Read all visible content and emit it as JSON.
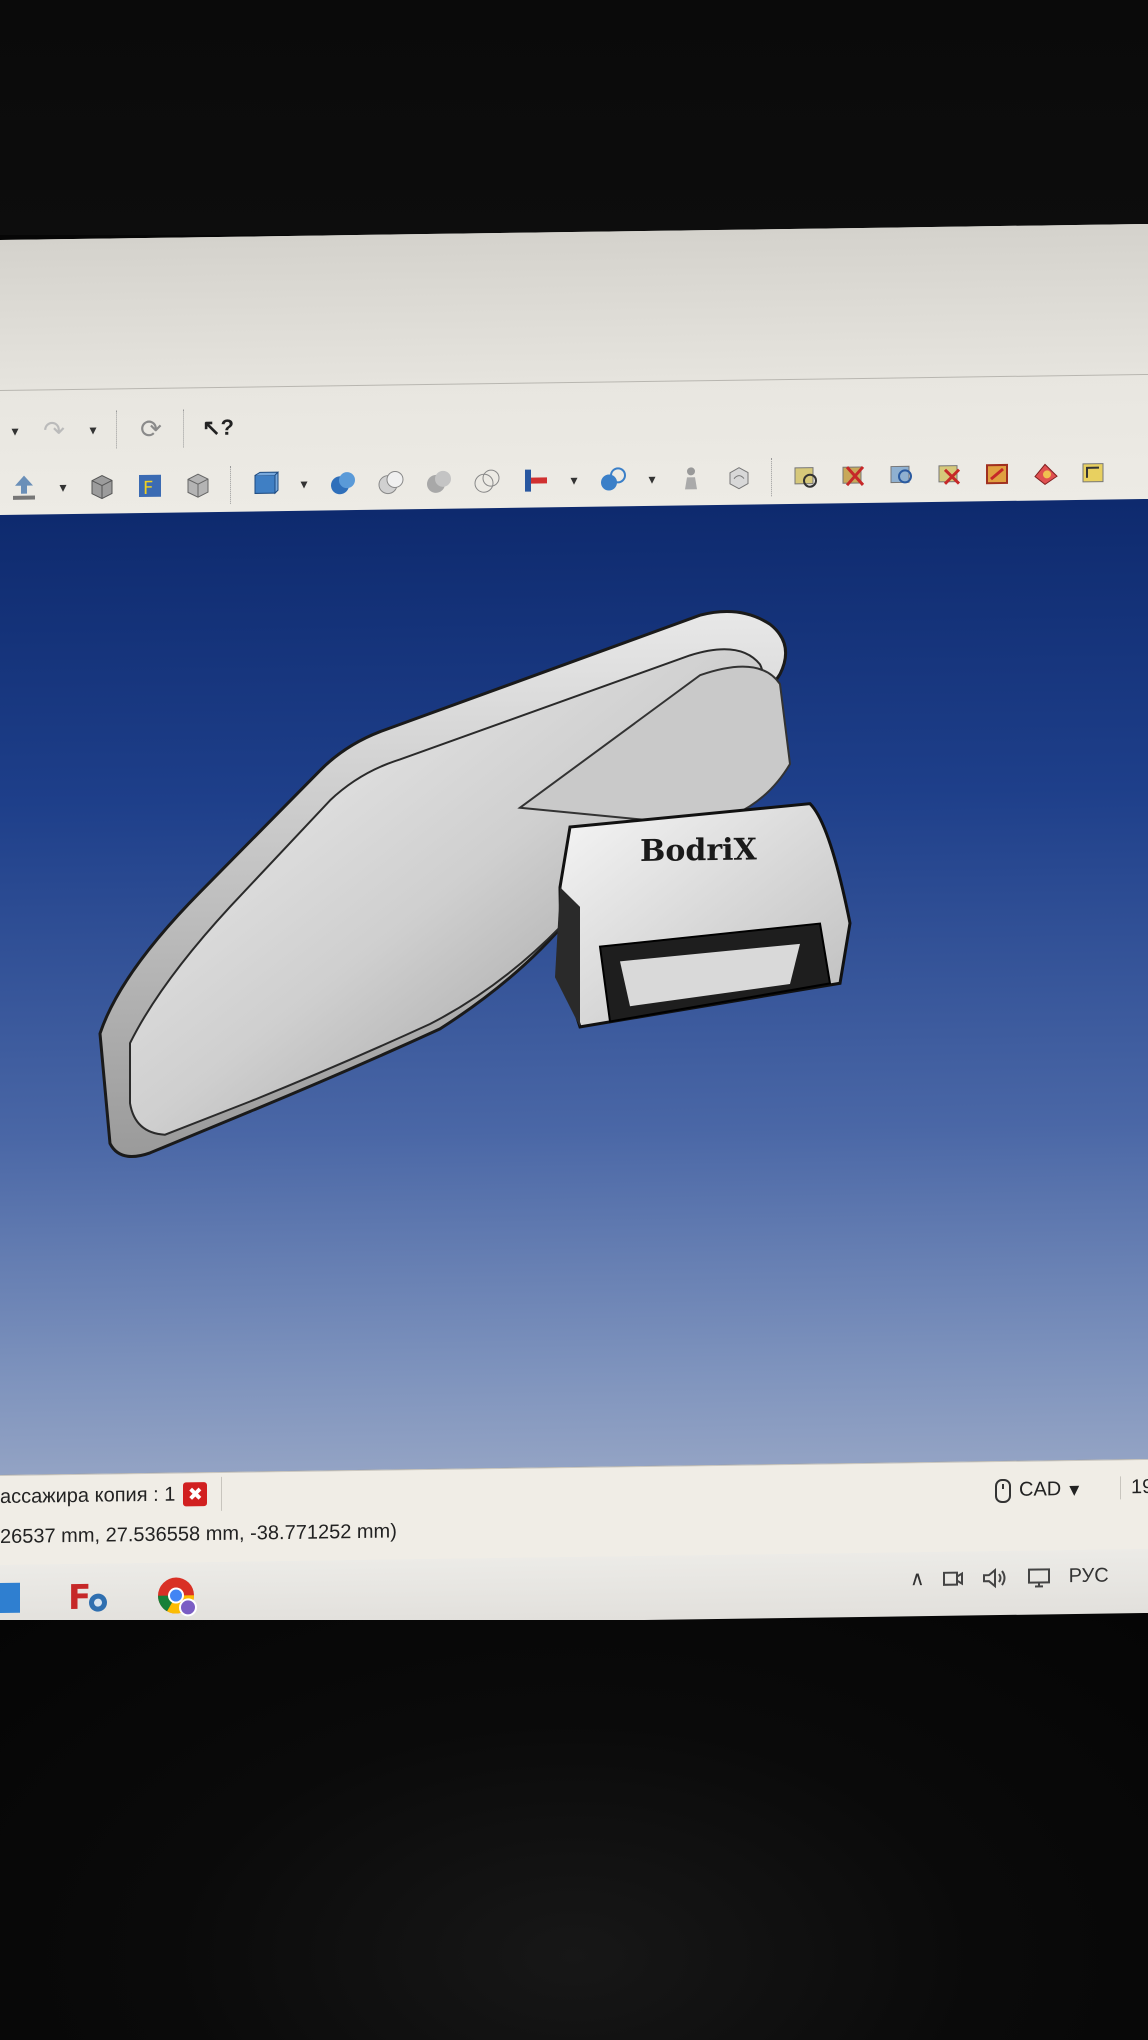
{
  "toolbar": {
    "row1": [
      {
        "name": "undo-dropdown-arrow",
        "glyph": "▾"
      },
      {
        "name": "redo-icon",
        "glyph": "↷"
      },
      {
        "name": "redo-dropdown-arrow",
        "glyph": "▾"
      },
      {
        "name": "refresh-icon",
        "glyph": "⟳"
      },
      {
        "name": "whats-this-icon",
        "glyph": "↖?"
      }
    ]
  },
  "viewport": {
    "model_label": "BodriX"
  },
  "status": {
    "document_tab": "ассажира копия : 1",
    "tab_close_glyph": "✖",
    "coordinates": "26537 mm, 27.536558 mm, -38.771252 mm)",
    "navigation_style": "CAD",
    "nav_dropdown_glyph": "▾",
    "cut_value": "19"
  },
  "taskbar": {
    "tray": {
      "chevron": "∧",
      "language": "РУС"
    }
  },
  "colors": {
    "viewport_top": "#0e2a6e",
    "viewport_bottom": "#93a3c4",
    "close_red": "#d12020",
    "freecad_red": "#c62828"
  }
}
